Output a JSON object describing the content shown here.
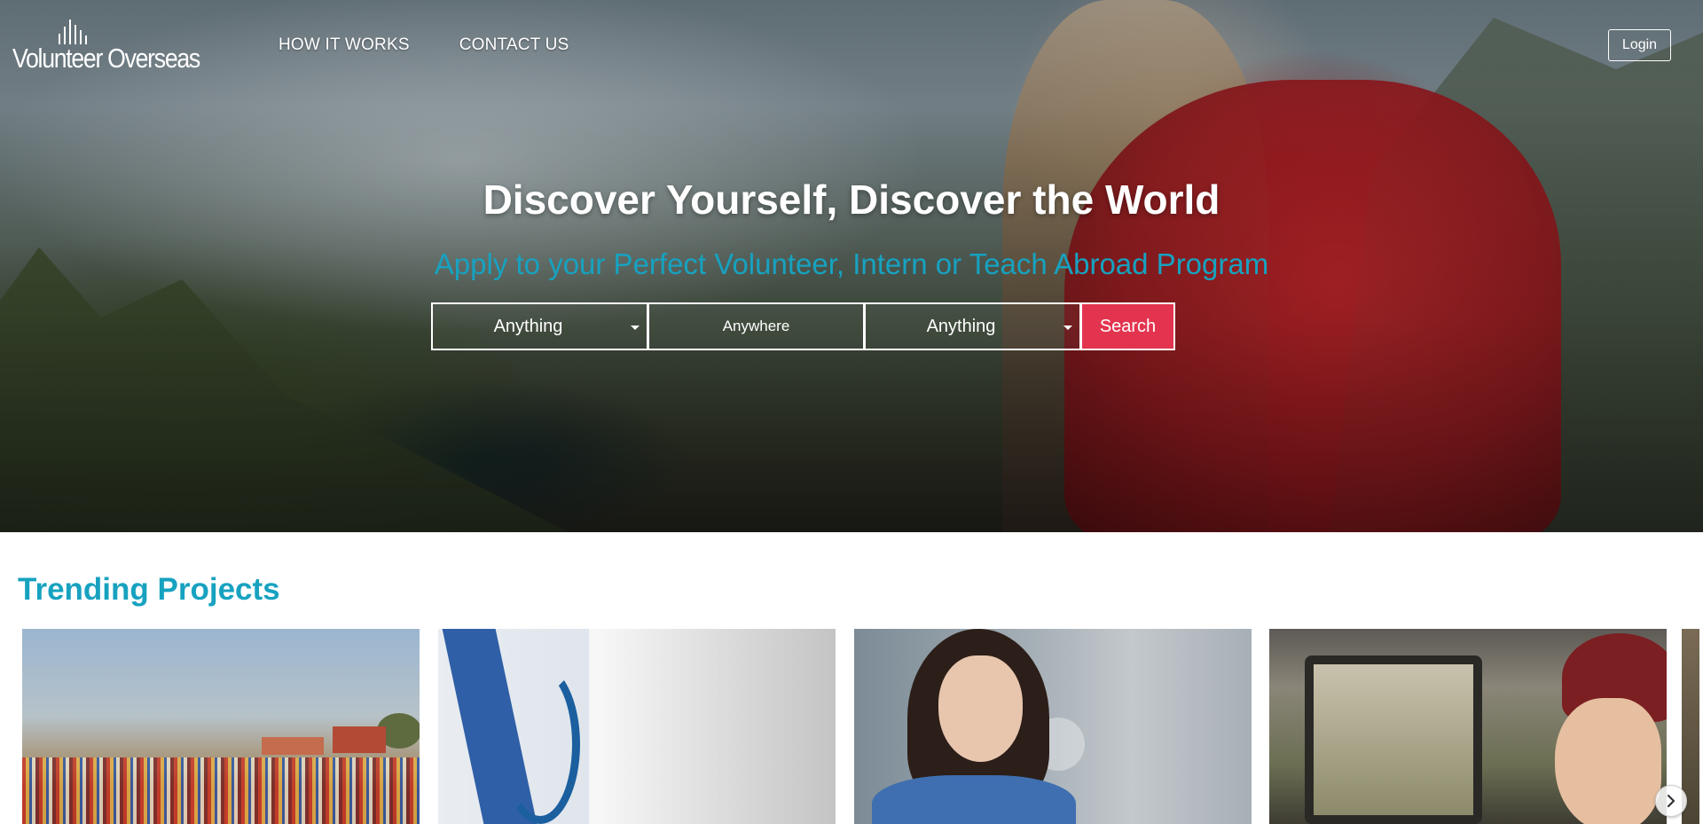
{
  "brand": {
    "logo_text": "Volunteer Overseas"
  },
  "nav": {
    "items": [
      {
        "label": "HOW IT WORKS"
      },
      {
        "label": "CONTACT US"
      }
    ]
  },
  "header": {
    "login_label": "Login"
  },
  "hero": {
    "headline": "Discover Yourself, Discover the World",
    "subhead": "Apply to your Perfect Volunteer, Intern or Teach Abroad Program",
    "subhead_color": "#17a2c0"
  },
  "search": {
    "field1_value": "Anything",
    "field2_value": "Anywhere",
    "field3_value": "Anything",
    "button_label": "Search",
    "button_color": "#e3344f"
  },
  "trending": {
    "title": "Trending Projects",
    "title_color": "#17a2c0"
  },
  "icons": {
    "carousel_next": "chevron-right-icon",
    "search_dropdown": "caret-down-icon"
  }
}
